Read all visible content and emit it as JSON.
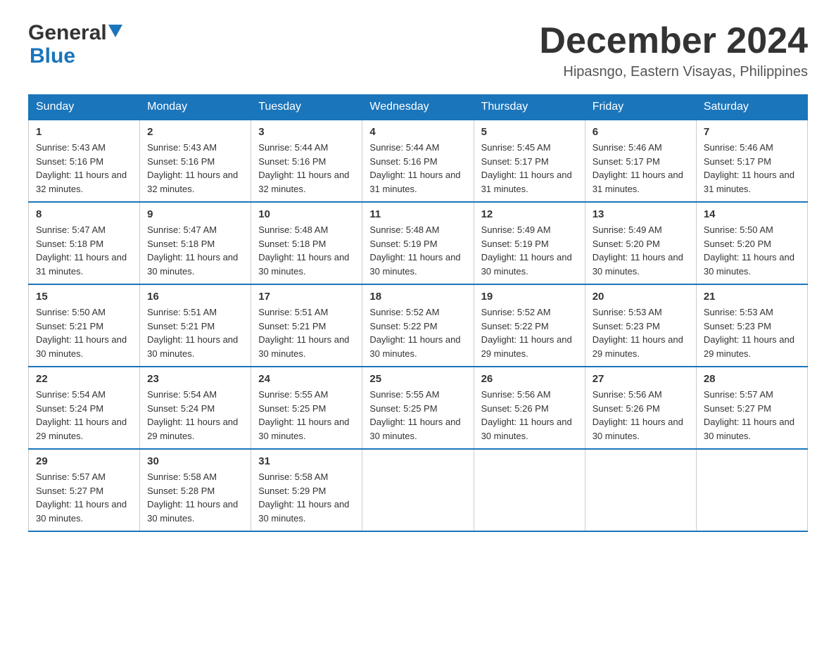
{
  "header": {
    "logo_general": "General",
    "logo_blue": "Blue",
    "month_title": "December 2024",
    "location": "Hipasngo, Eastern Visayas, Philippines"
  },
  "days_of_week": [
    "Sunday",
    "Monday",
    "Tuesday",
    "Wednesday",
    "Thursday",
    "Friday",
    "Saturday"
  ],
  "weeks": [
    [
      {
        "day": "1",
        "sunrise": "Sunrise: 5:43 AM",
        "sunset": "Sunset: 5:16 PM",
        "daylight": "Daylight: 11 hours and 32 minutes."
      },
      {
        "day": "2",
        "sunrise": "Sunrise: 5:43 AM",
        "sunset": "Sunset: 5:16 PM",
        "daylight": "Daylight: 11 hours and 32 minutes."
      },
      {
        "day": "3",
        "sunrise": "Sunrise: 5:44 AM",
        "sunset": "Sunset: 5:16 PM",
        "daylight": "Daylight: 11 hours and 32 minutes."
      },
      {
        "day": "4",
        "sunrise": "Sunrise: 5:44 AM",
        "sunset": "Sunset: 5:16 PM",
        "daylight": "Daylight: 11 hours and 31 minutes."
      },
      {
        "day": "5",
        "sunrise": "Sunrise: 5:45 AM",
        "sunset": "Sunset: 5:17 PM",
        "daylight": "Daylight: 11 hours and 31 minutes."
      },
      {
        "day": "6",
        "sunrise": "Sunrise: 5:46 AM",
        "sunset": "Sunset: 5:17 PM",
        "daylight": "Daylight: 11 hours and 31 minutes."
      },
      {
        "day": "7",
        "sunrise": "Sunrise: 5:46 AM",
        "sunset": "Sunset: 5:17 PM",
        "daylight": "Daylight: 11 hours and 31 minutes."
      }
    ],
    [
      {
        "day": "8",
        "sunrise": "Sunrise: 5:47 AM",
        "sunset": "Sunset: 5:18 PM",
        "daylight": "Daylight: 11 hours and 31 minutes."
      },
      {
        "day": "9",
        "sunrise": "Sunrise: 5:47 AM",
        "sunset": "Sunset: 5:18 PM",
        "daylight": "Daylight: 11 hours and 30 minutes."
      },
      {
        "day": "10",
        "sunrise": "Sunrise: 5:48 AM",
        "sunset": "Sunset: 5:18 PM",
        "daylight": "Daylight: 11 hours and 30 minutes."
      },
      {
        "day": "11",
        "sunrise": "Sunrise: 5:48 AM",
        "sunset": "Sunset: 5:19 PM",
        "daylight": "Daylight: 11 hours and 30 minutes."
      },
      {
        "day": "12",
        "sunrise": "Sunrise: 5:49 AM",
        "sunset": "Sunset: 5:19 PM",
        "daylight": "Daylight: 11 hours and 30 minutes."
      },
      {
        "day": "13",
        "sunrise": "Sunrise: 5:49 AM",
        "sunset": "Sunset: 5:20 PM",
        "daylight": "Daylight: 11 hours and 30 minutes."
      },
      {
        "day": "14",
        "sunrise": "Sunrise: 5:50 AM",
        "sunset": "Sunset: 5:20 PM",
        "daylight": "Daylight: 11 hours and 30 minutes."
      }
    ],
    [
      {
        "day": "15",
        "sunrise": "Sunrise: 5:50 AM",
        "sunset": "Sunset: 5:21 PM",
        "daylight": "Daylight: 11 hours and 30 minutes."
      },
      {
        "day": "16",
        "sunrise": "Sunrise: 5:51 AM",
        "sunset": "Sunset: 5:21 PM",
        "daylight": "Daylight: 11 hours and 30 minutes."
      },
      {
        "day": "17",
        "sunrise": "Sunrise: 5:51 AM",
        "sunset": "Sunset: 5:21 PM",
        "daylight": "Daylight: 11 hours and 30 minutes."
      },
      {
        "day": "18",
        "sunrise": "Sunrise: 5:52 AM",
        "sunset": "Sunset: 5:22 PM",
        "daylight": "Daylight: 11 hours and 30 minutes."
      },
      {
        "day": "19",
        "sunrise": "Sunrise: 5:52 AM",
        "sunset": "Sunset: 5:22 PM",
        "daylight": "Daylight: 11 hours and 29 minutes."
      },
      {
        "day": "20",
        "sunrise": "Sunrise: 5:53 AM",
        "sunset": "Sunset: 5:23 PM",
        "daylight": "Daylight: 11 hours and 29 minutes."
      },
      {
        "day": "21",
        "sunrise": "Sunrise: 5:53 AM",
        "sunset": "Sunset: 5:23 PM",
        "daylight": "Daylight: 11 hours and 29 minutes."
      }
    ],
    [
      {
        "day": "22",
        "sunrise": "Sunrise: 5:54 AM",
        "sunset": "Sunset: 5:24 PM",
        "daylight": "Daylight: 11 hours and 29 minutes."
      },
      {
        "day": "23",
        "sunrise": "Sunrise: 5:54 AM",
        "sunset": "Sunset: 5:24 PM",
        "daylight": "Daylight: 11 hours and 29 minutes."
      },
      {
        "day": "24",
        "sunrise": "Sunrise: 5:55 AM",
        "sunset": "Sunset: 5:25 PM",
        "daylight": "Daylight: 11 hours and 30 minutes."
      },
      {
        "day": "25",
        "sunrise": "Sunrise: 5:55 AM",
        "sunset": "Sunset: 5:25 PM",
        "daylight": "Daylight: 11 hours and 30 minutes."
      },
      {
        "day": "26",
        "sunrise": "Sunrise: 5:56 AM",
        "sunset": "Sunset: 5:26 PM",
        "daylight": "Daylight: 11 hours and 30 minutes."
      },
      {
        "day": "27",
        "sunrise": "Sunrise: 5:56 AM",
        "sunset": "Sunset: 5:26 PM",
        "daylight": "Daylight: 11 hours and 30 minutes."
      },
      {
        "day": "28",
        "sunrise": "Sunrise: 5:57 AM",
        "sunset": "Sunset: 5:27 PM",
        "daylight": "Daylight: 11 hours and 30 minutes."
      }
    ],
    [
      {
        "day": "29",
        "sunrise": "Sunrise: 5:57 AM",
        "sunset": "Sunset: 5:27 PM",
        "daylight": "Daylight: 11 hours and 30 minutes."
      },
      {
        "day": "30",
        "sunrise": "Sunrise: 5:58 AM",
        "sunset": "Sunset: 5:28 PM",
        "daylight": "Daylight: 11 hours and 30 minutes."
      },
      {
        "day": "31",
        "sunrise": "Sunrise: 5:58 AM",
        "sunset": "Sunset: 5:29 PM",
        "daylight": "Daylight: 11 hours and 30 minutes."
      },
      null,
      null,
      null,
      null
    ]
  ]
}
